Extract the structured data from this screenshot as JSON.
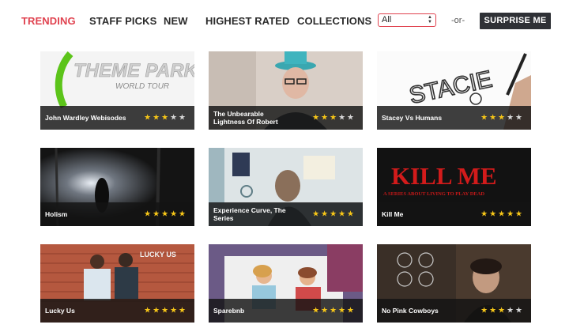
{
  "nav": {
    "tabs": [
      {
        "label": "TRENDING",
        "active": true
      },
      {
        "label": "STAFF PICKS",
        "active": false
      },
      {
        "label": "NEW",
        "active": false
      },
      {
        "label": "HIGHEST RATED",
        "active": false
      },
      {
        "label": "COLLECTIONS",
        "active": false
      }
    ],
    "filter_value": "All",
    "or_label": "-or-",
    "surprise_label": "SURPRISE ME"
  },
  "videos": [
    {
      "title": "John Wardley Webisodes",
      "rating": 3,
      "thumb_text": "THEME PARK",
      "thumb_sub": "WORLD TOUR"
    },
    {
      "title": "The Unbearable Lightness Of Robert",
      "rating": 3
    },
    {
      "title": "Stacey Vs Humans",
      "rating": 3,
      "thumb_text": "STACIE"
    },
    {
      "title": "Holism",
      "rating": 5
    },
    {
      "title": "Experience Curve, The Series",
      "rating": 5
    },
    {
      "title": "Kill Me",
      "rating": 5,
      "thumb_text": "KILL ME",
      "thumb_sub": "A SERIES ABOUT LIVING TO PLAY DEAD"
    },
    {
      "title": "Lucky Us",
      "rating": 5,
      "thumb_text": "LUCKY US"
    },
    {
      "title": "Sparebnb",
      "rating": 5
    },
    {
      "title": "No Pink Cowboys",
      "rating": 3
    }
  ],
  "colors": {
    "accent": "#e0424f",
    "star_on": "#f5c518",
    "star_off": "#d6d6d6",
    "button_bg": "#2f3136"
  }
}
